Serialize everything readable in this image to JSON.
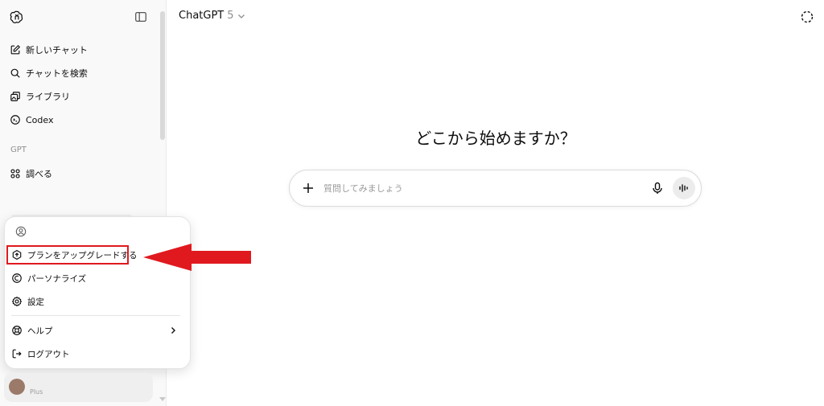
{
  "sidebar": {
    "items": [
      {
        "label": "新しいチャット",
        "icon": "new-chat-icon"
      },
      {
        "label": "チャットを検索",
        "icon": "search-icon"
      },
      {
        "label": "ライブラリ",
        "icon": "library-icon"
      },
      {
        "label": "Codex",
        "icon": "codex-icon"
      }
    ],
    "gpt_section_label": "GPT",
    "gpt_items": [
      {
        "label": "調べる",
        "icon": "explore-icon"
      }
    ]
  },
  "account_menu": {
    "items": [
      {
        "label": "プランをアップグレードする",
        "icon": "upgrade-icon",
        "highlighted": true
      },
      {
        "label": "パーソナライズ",
        "icon": "personalize-icon"
      },
      {
        "label": "設定",
        "icon": "gear-icon"
      },
      {
        "label": "ヘルプ",
        "icon": "help-icon",
        "has_submenu": true
      },
      {
        "label": "ログアウト",
        "icon": "logout-icon"
      }
    ],
    "highlight_color": "#e0191f"
  },
  "account": {
    "plan": "Plus",
    "avatar_color": "#9b7a6a"
  },
  "header": {
    "model_name": "ChatGPT",
    "model_version": "5"
  },
  "main": {
    "headline": "どこから始めますか？",
    "composer_placeholder": "質問してみましょう"
  }
}
